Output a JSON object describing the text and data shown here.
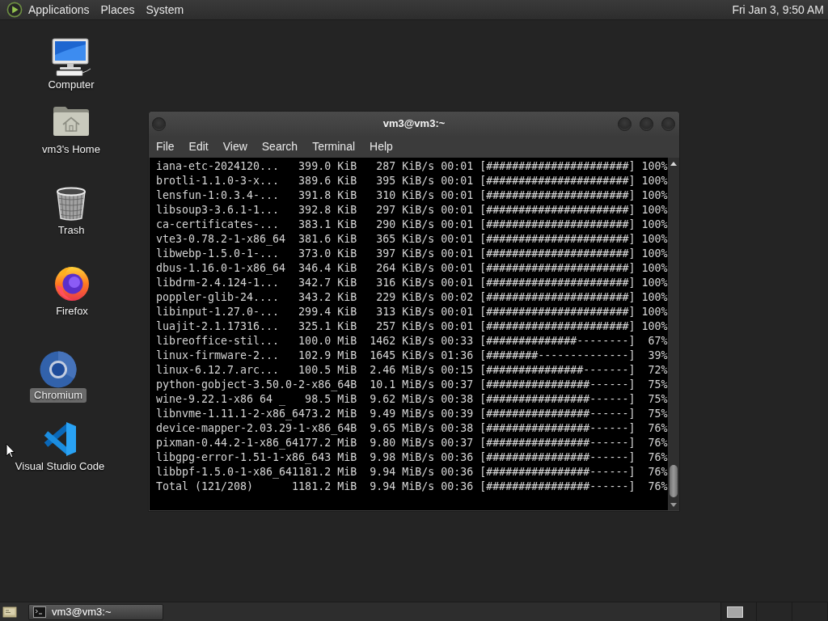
{
  "top_panel": {
    "menus": [
      "Applications",
      "Places",
      "System"
    ],
    "clock": "Fri Jan 3, 9:50 AM"
  },
  "desktop_icons": [
    {
      "label": "Computer",
      "kind": "monitor",
      "selected": false
    },
    {
      "label": "vm3's Home",
      "kind": "homefolder",
      "selected": false
    },
    {
      "label": "Trash",
      "kind": "trash",
      "selected": false
    },
    {
      "label": "Firefox",
      "kind": "flameglobe",
      "selected": false
    },
    {
      "label": "Chromium",
      "kind": "ring",
      "selected": true
    },
    {
      "label": "Visual Studio Code",
      "kind": "ribbon",
      "selected": false
    }
  ],
  "terminal_window": {
    "title": "vm3@vm3:~",
    "menus": [
      "File",
      "Edit",
      "View",
      "Search",
      "Terminal",
      "Help"
    ],
    "lines": [
      "iana-etc-2024120...   399.0 KiB   287 KiB/s 00:01 [######################] 100%",
      "brotli-1.1.0-3-x...   389.6 KiB   395 KiB/s 00:01 [######################] 100%",
      "lensfun-1:0.3.4-...   391.8 KiB   310 KiB/s 00:01 [######################] 100%",
      "libsoup3-3.6.1-1...   392.8 KiB   297 KiB/s 00:01 [######################] 100%",
      "ca-certificates-...   383.1 KiB   290 KiB/s 00:01 [######################] 100%",
      "vte3-0.78.2-1-x86_64  381.6 KiB   365 KiB/s 00:01 [######################] 100%",
      "libwebp-1.5.0-1-...   373.0 KiB   397 KiB/s 00:01 [######################] 100%",
      "dbus-1.16.0-1-x86_64  346.4 KiB   264 KiB/s 00:01 [######################] 100%",
      "libdrm-2.4.124-1...   342.7 KiB   316 KiB/s 00:01 [######################] 100%",
      "poppler-glib-24....   343.2 KiB   229 KiB/s 00:02 [######################] 100%",
      "libinput-1.27.0-...   299.4 KiB   313 KiB/s 00:01 [######################] 100%",
      "luajit-2.1.17316...   325.1 KiB   257 KiB/s 00:01 [######################] 100%",
      "libreoffice-stil...   100.0 MiB  1462 KiB/s 00:33 [##############--------]  67%",
      "linux-firmware-2...   102.9 MiB  1645 KiB/s 01:36 [########--------------]  39%",
      "linux-6.12.7.arc...   100.5 MiB  2.46 MiB/s 00:15 [###############-------]  72%",
      "python-gobject-3.50.0-2-x86_64B  10.1 MiB/s 00:37 [################------]  75%",
      "wine-9.22.1-x86 64 _   98.5 MiB  9.62 MiB/s 00:38 [################------]  75%",
      "libnvme-1.11.1-2-x86_6473.2 MiB  9.49 MiB/s 00:39 [################------]  75%",
      "device-mapper-2.03.29-1-x86_64B  9.65 MiB/s 00:38 [################------]  76%",
      "pixman-0.44.2-1-x86_64177.2 MiB  9.80 MiB/s 00:37 [################------]  76%",
      "libgpg-error-1.51-1-x86_643 MiB  9.98 MiB/s 00:36 [################------]  76%",
      "libbpf-1.5.0-1-x86_641181.2 MiB  9.94 MiB/s 00:36 [################------]  76%",
      "Total (121/208)      1181.2 MiB  9.94 MiB/s 00:36 [################------]  76%"
    ]
  },
  "taskbar": {
    "tasks": [
      {
        "label": "vm3@vm3:~"
      }
    ]
  }
}
